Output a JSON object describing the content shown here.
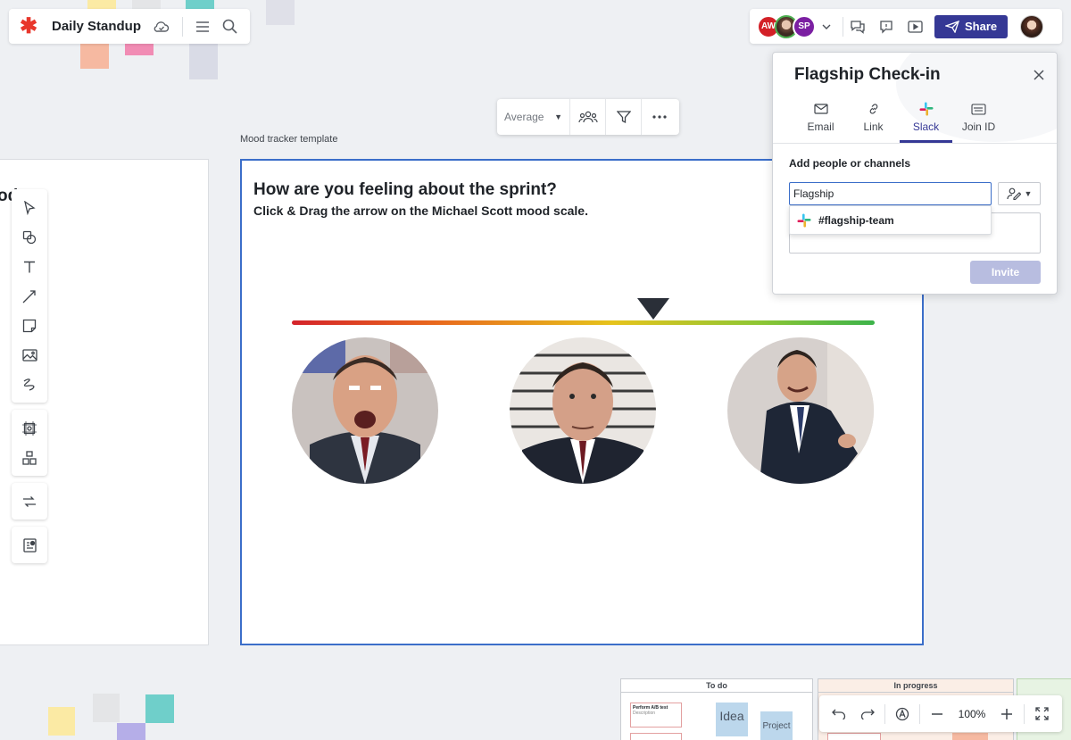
{
  "document": {
    "title": "Daily Standup"
  },
  "collaborators": [
    {
      "initials": "AW",
      "color": "#d32027"
    },
    {
      "initials": "",
      "color": ""
    },
    {
      "initials": "SP",
      "color": "#7b1fa2"
    }
  ],
  "header": {
    "share_label": "Share",
    "accent": "#353895"
  },
  "context_toolbar": {
    "select_value": "Average"
  },
  "frame": {
    "template_label": "Mood tracker template",
    "heading": "How are you feeling about the sprint?",
    "subheading": "Click & Drag the arrow on the Michael Scott mood scale.",
    "scale_arrow_position": 0.62
  },
  "left_card": {
    "partial_text": "od"
  },
  "share_panel": {
    "title": "Flagship Check-in",
    "tabs": [
      {
        "label": "Email",
        "icon": "mail-icon"
      },
      {
        "label": "Link",
        "icon": "link-icon"
      },
      {
        "label": "Slack",
        "icon": "slack-icon",
        "active": true
      },
      {
        "label": "Join ID",
        "icon": "join-id-icon"
      }
    ],
    "add_label": "Add people or channels",
    "input_value": "Flagship",
    "suggestion": "#flagship-team",
    "invite_label": "Invite"
  },
  "kanban": {
    "columns": [
      "To do",
      "In progress"
    ],
    "card_title": "Perform A/B test",
    "card_sub": "Description",
    "stickies": [
      "Idea",
      "Project"
    ]
  },
  "zoom": {
    "value": "100%"
  }
}
